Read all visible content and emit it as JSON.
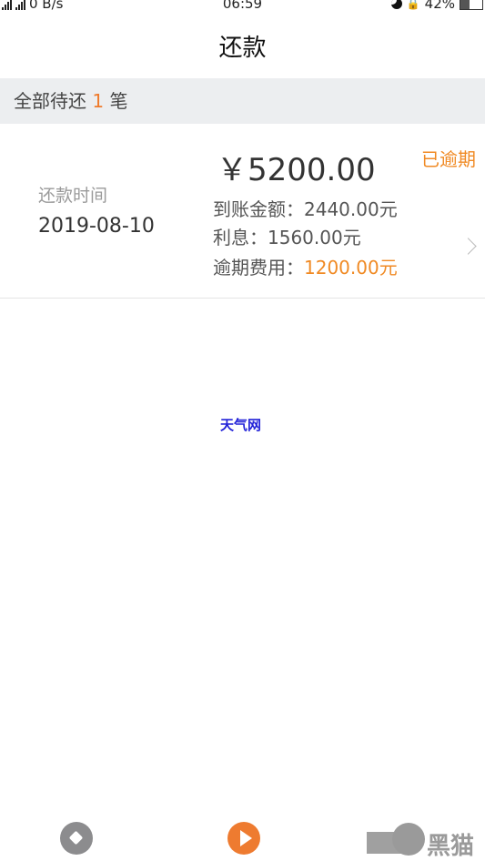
{
  "status_bar": {
    "network_1": "2G",
    "network_2": "4G",
    "speed": "0 B/s",
    "time": "06:59",
    "battery": "42%",
    "battery_level": 0.42
  },
  "header": {
    "title": "还款"
  },
  "summary": {
    "prefix": "全部待还",
    "count": "1",
    "suffix": "笔"
  },
  "records": [
    {
      "date_label": "还款时间",
      "date": "2019-08-10",
      "amount": "￥5200.00",
      "status": "已逾期",
      "received_label": "到账金额：",
      "received_value": "2440.00元",
      "interest_label": "利息：",
      "interest_value": "1560.00元",
      "overdue_fee_label": "逾期费用：",
      "overdue_fee_value": "1200.00元"
    }
  ],
  "watermark": {
    "center_text": "天气网",
    "corner_text": "黑猫"
  },
  "colors": {
    "accent_orange": "#f08a24",
    "summary_bg": "#eceef0",
    "watermark_blue": "#2323d8"
  }
}
